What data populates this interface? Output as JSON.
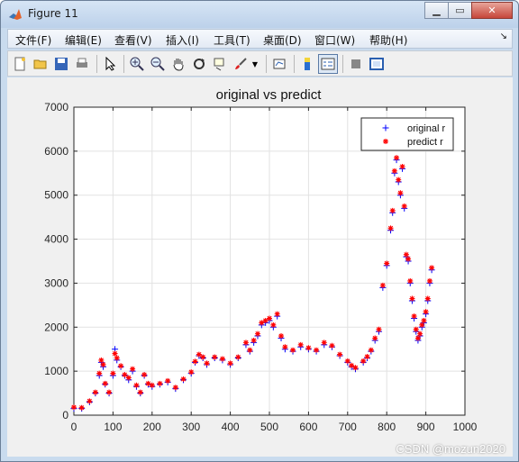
{
  "window": {
    "title": "Figure 11"
  },
  "menu": [
    {
      "label": "文件(F)",
      "key": "file"
    },
    {
      "label": "编辑(E)",
      "key": "edit"
    },
    {
      "label": "查看(V)",
      "key": "view"
    },
    {
      "label": "插入(I)",
      "key": "insert"
    },
    {
      "label": "工具(T)",
      "key": "tools"
    },
    {
      "label": "桌面(D)",
      "key": "desktop"
    },
    {
      "label": "窗口(W)",
      "key": "window"
    },
    {
      "label": "帮助(H)",
      "key": "help"
    }
  ],
  "toolbar_icons": [
    "new-figure-icon",
    "open-folder-icon",
    "save-icon",
    "print-icon",
    "pointer-icon",
    "zoom-in-icon",
    "zoom-out-icon",
    "pan-hand-icon",
    "rotate-3d-icon",
    "data-cursor-icon",
    "brush-icon",
    "dropdown-arrow-icon",
    "link-plot-icon",
    "colorbar-icon",
    "legend-icon",
    "hide-plot-tools-icon",
    "show-plot-tools-icon"
  ],
  "chart_data": {
    "type": "scatter",
    "title": "original vs predict",
    "xlabel": "",
    "ylabel": "",
    "xlim": [
      0,
      1000
    ],
    "ylim": [
      0,
      7000
    ],
    "xticks": [
      0,
      100,
      200,
      300,
      400,
      500,
      600,
      700,
      800,
      900,
      1000
    ],
    "yticks": [
      0,
      1000,
      2000,
      3000,
      4000,
      5000,
      6000,
      7000
    ],
    "grid": true,
    "legend_position": "top-right",
    "series": [
      {
        "name": "original r",
        "marker": "+",
        "color": "#0000ff",
        "x": [
          0,
          20,
          40,
          55,
          65,
          70,
          75,
          80,
          90,
          100,
          105,
          110,
          120,
          130,
          140,
          150,
          160,
          170,
          180,
          190,
          200,
          220,
          240,
          260,
          280,
          300,
          310,
          320,
          330,
          340,
          360,
          380,
          400,
          420,
          440,
          450,
          460,
          470,
          480,
          490,
          500,
          510,
          520,
          530,
          540,
          560,
          580,
          600,
          620,
          640,
          660,
          680,
          700,
          710,
          720,
          740,
          750,
          760,
          770,
          780,
          790,
          800,
          810,
          815,
          820,
          825,
          830,
          835,
          840,
          845,
          850,
          855,
          860,
          865,
          870,
          875,
          880,
          885,
          890,
          895,
          900,
          905,
          910,
          915
        ],
        "y": [
          150,
          150,
          300,
          500,
          900,
          1200,
          1100,
          700,
          500,
          900,
          1500,
          1250,
          1100,
          900,
          800,
          1000,
          650,
          500,
          900,
          700,
          650,
          700,
          750,
          600,
          800,
          950,
          1200,
          1350,
          1300,
          1150,
          1300,
          1250,
          1150,
          1300,
          1600,
          1450,
          1650,
          1800,
          2050,
          2100,
          2150,
          2000,
          2250,
          1750,
          1500,
          1450,
          1550,
          1500,
          1450,
          1600,
          1550,
          1350,
          1200,
          1100,
          1050,
          1200,
          1300,
          1450,
          1700,
          1900,
          2900,
          3400,
          4200,
          4600,
          5500,
          5800,
          5300,
          5000,
          5600,
          4700,
          3600,
          3500,
          3000,
          2600,
          2200,
          1900,
          1700,
          1800,
          2000,
          2100,
          2300,
          2600,
          3000,
          3300
        ]
      },
      {
        "name": "predict r",
        "marker": "*",
        "color": "#ff0000",
        "x": [
          0,
          20,
          40,
          55,
          65,
          70,
          75,
          80,
          90,
          100,
          105,
          110,
          120,
          130,
          140,
          150,
          160,
          170,
          180,
          190,
          200,
          220,
          240,
          260,
          280,
          300,
          310,
          320,
          330,
          340,
          360,
          380,
          400,
          420,
          440,
          450,
          460,
          470,
          480,
          490,
          500,
          510,
          520,
          530,
          540,
          560,
          580,
          600,
          620,
          640,
          660,
          680,
          700,
          710,
          720,
          740,
          750,
          760,
          770,
          780,
          790,
          800,
          810,
          815,
          820,
          825,
          830,
          835,
          840,
          845,
          850,
          855,
          860,
          865,
          870,
          875,
          880,
          885,
          890,
          895,
          900,
          905,
          910,
          915
        ],
        "y": [
          180,
          170,
          320,
          520,
          950,
          1250,
          1150,
          720,
          520,
          950,
          1400,
          1300,
          1120,
          920,
          850,
          1050,
          680,
          520,
          920,
          720,
          680,
          720,
          780,
          630,
          820,
          980,
          1220,
          1380,
          1320,
          1180,
          1320,
          1280,
          1180,
          1320,
          1650,
          1480,
          1700,
          1850,
          2100,
          2150,
          2200,
          2050,
          2300,
          1800,
          1550,
          1480,
          1600,
          1530,
          1480,
          1650,
          1580,
          1380,
          1230,
          1130,
          1080,
          1230,
          1330,
          1480,
          1750,
          1950,
          2950,
          3450,
          4250,
          4650,
          5550,
          5850,
          5350,
          5050,
          5650,
          4750,
          3650,
          3550,
          3050,
          2650,
          2250,
          1950,
          1750,
          1850,
          2050,
          2150,
          2350,
          2650,
          3050,
          3350
        ]
      }
    ]
  },
  "watermark": "CSDN @mozun2020"
}
